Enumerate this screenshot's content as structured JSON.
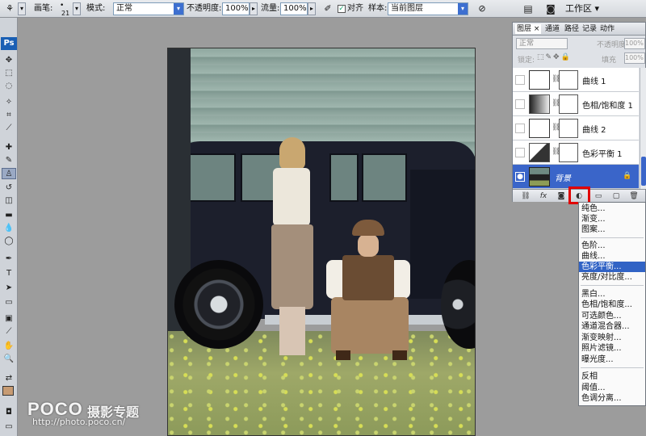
{
  "options_bar": {
    "brush_label": "画笔:",
    "brush_size": "21",
    "mode_label": "模式:",
    "mode_value": "正常",
    "opacity_label": "不透明度:",
    "opacity_value": "100%",
    "flow_label": "流量:",
    "flow_value": "100%",
    "aligned_label": "对齐",
    "sample_label": "样本:",
    "sample_value": "当前图层",
    "workspace_label": "工作区 ▾"
  },
  "toolbox": {
    "logo": "Ps"
  },
  "layers_panel": {
    "tabs": [
      "图层 ×",
      "通道",
      "路径",
      "记录",
      "动作"
    ],
    "blend_mode": "正常",
    "opacity_label": "不透明度",
    "opacity_value": "100%",
    "lock_label": "锁定:",
    "fill_label": "填充",
    "fill_value": "100%",
    "layers": [
      {
        "name": "曲线 1",
        "type": "curves",
        "selected": false
      },
      {
        "name": "色相/饱和度 1",
        "type": "hue-saturation",
        "selected": false
      },
      {
        "name": "曲线 2",
        "type": "curves",
        "selected": false
      },
      {
        "name": "色彩平衡 1",
        "type": "color-balance",
        "selected": false
      },
      {
        "name": "背景",
        "type": "background",
        "selected": true
      }
    ],
    "bottom_icons": [
      "link-icon",
      "fx-icon",
      "mask-icon",
      "adjustment-icon",
      "folder-icon",
      "new-layer-icon",
      "trash-icon"
    ]
  },
  "adjustment_menu": {
    "groups": [
      [
        "纯色...",
        "渐变...",
        "图案..."
      ],
      [
        "色阶...",
        "曲线...",
        "色彩平衡...",
        "亮度/对比度..."
      ],
      [
        "黑白...",
        "色相/饱和度...",
        "可选颜色...",
        "通道混合器...",
        "渐变映射...",
        "照片滤镜...",
        "曝光度..."
      ],
      [
        "反相",
        "阈值...",
        "色调分离..."
      ]
    ],
    "highlighted": "色彩平衡..."
  },
  "watermark": {
    "logo": "POCO",
    "title": "摄影专题",
    "url": "http://photo.poco.cn/"
  },
  "colors": {
    "selection_blue": "#3163c5",
    "highlight_red": "#e10000",
    "panel_bg": "#dfe2e7",
    "canvas_bg": "#9c9c9c"
  }
}
